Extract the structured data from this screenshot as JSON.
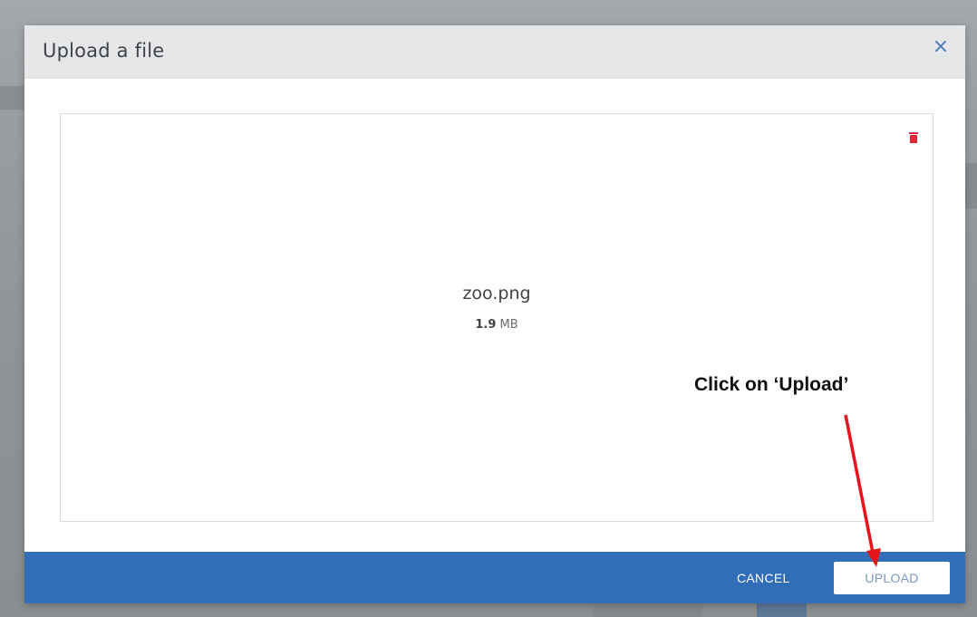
{
  "dialog": {
    "title": "Upload a file",
    "close_glyph": "×",
    "close_icon": "close-icon"
  },
  "file": {
    "name": "zoo.png",
    "size_value": "1.9",
    "size_unit": "MB",
    "delete_icon": "trash-icon"
  },
  "footer": {
    "cancel_label": "CANCEL",
    "upload_label": "UPLOAD"
  },
  "annotation": {
    "text": "Click on ‘Upload’",
    "arrow_color": "#e8141b"
  },
  "colors": {
    "header_bg": "#e6e7e8",
    "footer_bg": "#326db7",
    "accent": "#4a79b5",
    "delete_red": "#e02a3a"
  }
}
